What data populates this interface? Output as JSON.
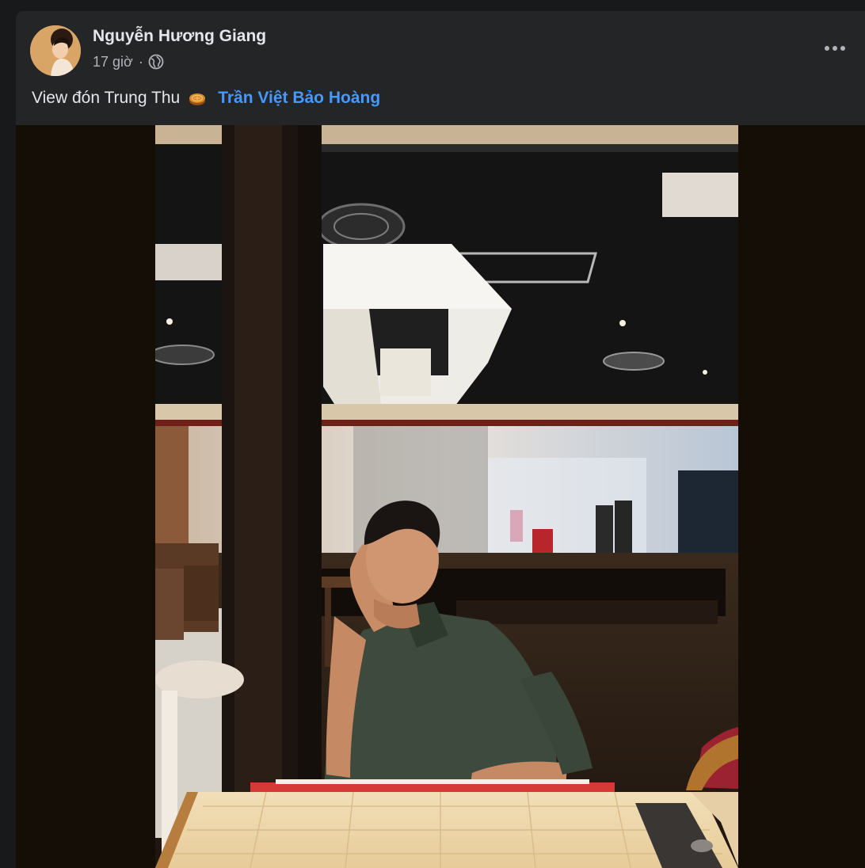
{
  "post": {
    "author": "Nguyễn Hương Giang",
    "time": "17 giờ",
    "separator": "·",
    "audience_icon": "globe-icon",
    "more_icon": "more-options-icon",
    "caption": "View đón Trung Thu",
    "caption_emoji": "mooncake-icon",
    "tagged_person": "Trần Việt Bảo Hoàng"
  },
  "colors": {
    "background": "#18191a",
    "card": "#242526",
    "text_primary": "#e4e6eb",
    "text_secondary": "#b0b3b8",
    "link": "#4599ff"
  }
}
